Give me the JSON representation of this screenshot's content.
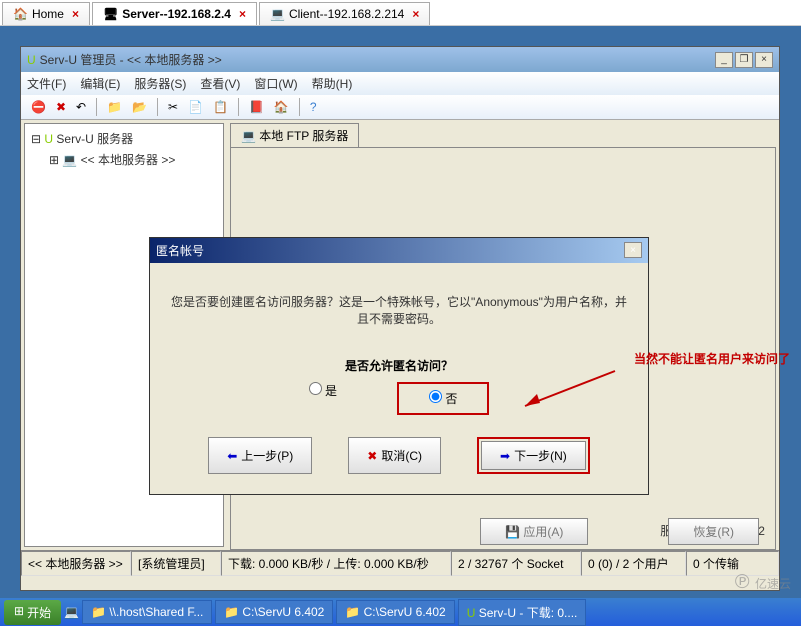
{
  "outerTabs": [
    {
      "icon": "home-icon",
      "label": "Home",
      "closeable": true
    },
    {
      "icon": "server-icon",
      "label": "Server--192.168.2.4",
      "closeable": true,
      "active": true
    },
    {
      "icon": "client-icon",
      "label": "Client--192.168.2.214",
      "closeable": true
    }
  ],
  "window": {
    "title": "Serv-U 管理员 - << 本地服务器 >>",
    "menu": [
      {
        "label": "文件(F)"
      },
      {
        "label": "编辑(E)"
      },
      {
        "label": "服务器(S)"
      },
      {
        "label": "查看(V)"
      },
      {
        "label": "窗口(W)"
      },
      {
        "label": "帮助(H)"
      }
    ]
  },
  "tree": {
    "root": "Serv-U 服务器",
    "child": "<< 本地服务器 >>"
  },
  "rightTab": "本地 FTP 服务器",
  "buildLabel": "服务器 build 6.4.0.2",
  "bottomButtons": {
    "apply": "应用(A)",
    "restore": "恢复(R)"
  },
  "dialog": {
    "title": "匿名帐号",
    "message": "您是否要创建匿名访问服务器？这是一个特殊帐号，它以\"Anonymous\"为用户名称，并且不需要密码。",
    "question": "是否允许匿名访问？",
    "optYes": "是",
    "optNo": "否",
    "selectedOption": "no",
    "prev": "上一步(P)",
    "cancel": "取消(C)",
    "next": "下一步(N)"
  },
  "annotation": "当然不能让匿名用户来访问了",
  "statusbar": {
    "s1": "<< 本地服务器 >>",
    "s2": "[系统管理员]",
    "s3": "下载: 0.000 KB/秒 / 上传: 0.000 KB/秒",
    "s4": "2 / 32767 个 Socket",
    "s5": "0 (0) / 2 个用户",
    "s6": "0 个传输"
  },
  "taskbar": {
    "start": "开始",
    "items": [
      "\\\\.host\\Shared F...",
      "C:\\ServU 6.402",
      "C:\\ServU 6.402",
      "Serv-U - 下载: 0...."
    ]
  },
  "watermark": "亿速云"
}
